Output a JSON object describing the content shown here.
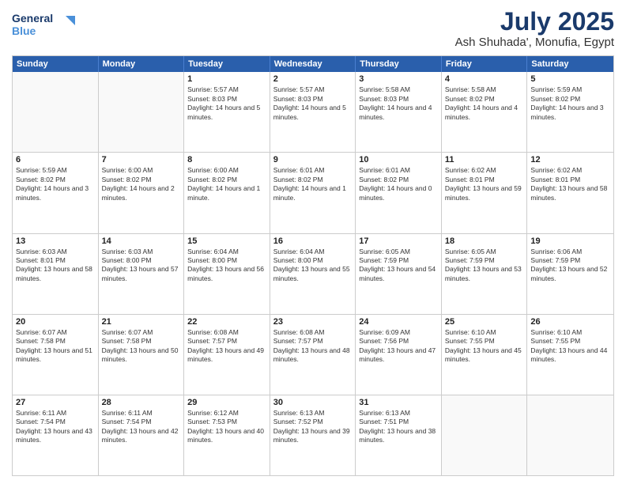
{
  "logo": {
    "line1": "General",
    "line2": "Blue"
  },
  "title": "July 2025",
  "location": "Ash Shuhada', Monufia, Egypt",
  "header_days": [
    "Sunday",
    "Monday",
    "Tuesday",
    "Wednesday",
    "Thursday",
    "Friday",
    "Saturday"
  ],
  "weeks": [
    [
      {
        "day": "",
        "sunrise": "",
        "sunset": "",
        "daylight": ""
      },
      {
        "day": "",
        "sunrise": "",
        "sunset": "",
        "daylight": ""
      },
      {
        "day": "1",
        "sunrise": "Sunrise: 5:57 AM",
        "sunset": "Sunset: 8:03 PM",
        "daylight": "Daylight: 14 hours and 5 minutes."
      },
      {
        "day": "2",
        "sunrise": "Sunrise: 5:57 AM",
        "sunset": "Sunset: 8:03 PM",
        "daylight": "Daylight: 14 hours and 5 minutes."
      },
      {
        "day": "3",
        "sunrise": "Sunrise: 5:58 AM",
        "sunset": "Sunset: 8:03 PM",
        "daylight": "Daylight: 14 hours and 4 minutes."
      },
      {
        "day": "4",
        "sunrise": "Sunrise: 5:58 AM",
        "sunset": "Sunset: 8:02 PM",
        "daylight": "Daylight: 14 hours and 4 minutes."
      },
      {
        "day": "5",
        "sunrise": "Sunrise: 5:59 AM",
        "sunset": "Sunset: 8:02 PM",
        "daylight": "Daylight: 14 hours and 3 minutes."
      }
    ],
    [
      {
        "day": "6",
        "sunrise": "Sunrise: 5:59 AM",
        "sunset": "Sunset: 8:02 PM",
        "daylight": "Daylight: 14 hours and 3 minutes."
      },
      {
        "day": "7",
        "sunrise": "Sunrise: 6:00 AM",
        "sunset": "Sunset: 8:02 PM",
        "daylight": "Daylight: 14 hours and 2 minutes."
      },
      {
        "day": "8",
        "sunrise": "Sunrise: 6:00 AM",
        "sunset": "Sunset: 8:02 PM",
        "daylight": "Daylight: 14 hours and 1 minute."
      },
      {
        "day": "9",
        "sunrise": "Sunrise: 6:01 AM",
        "sunset": "Sunset: 8:02 PM",
        "daylight": "Daylight: 14 hours and 1 minute."
      },
      {
        "day": "10",
        "sunrise": "Sunrise: 6:01 AM",
        "sunset": "Sunset: 8:02 PM",
        "daylight": "Daylight: 14 hours and 0 minutes."
      },
      {
        "day": "11",
        "sunrise": "Sunrise: 6:02 AM",
        "sunset": "Sunset: 8:01 PM",
        "daylight": "Daylight: 13 hours and 59 minutes."
      },
      {
        "day": "12",
        "sunrise": "Sunrise: 6:02 AM",
        "sunset": "Sunset: 8:01 PM",
        "daylight": "Daylight: 13 hours and 58 minutes."
      }
    ],
    [
      {
        "day": "13",
        "sunrise": "Sunrise: 6:03 AM",
        "sunset": "Sunset: 8:01 PM",
        "daylight": "Daylight: 13 hours and 58 minutes."
      },
      {
        "day": "14",
        "sunrise": "Sunrise: 6:03 AM",
        "sunset": "Sunset: 8:00 PM",
        "daylight": "Daylight: 13 hours and 57 minutes."
      },
      {
        "day": "15",
        "sunrise": "Sunrise: 6:04 AM",
        "sunset": "Sunset: 8:00 PM",
        "daylight": "Daylight: 13 hours and 56 minutes."
      },
      {
        "day": "16",
        "sunrise": "Sunrise: 6:04 AM",
        "sunset": "Sunset: 8:00 PM",
        "daylight": "Daylight: 13 hours and 55 minutes."
      },
      {
        "day": "17",
        "sunrise": "Sunrise: 6:05 AM",
        "sunset": "Sunset: 7:59 PM",
        "daylight": "Daylight: 13 hours and 54 minutes."
      },
      {
        "day": "18",
        "sunrise": "Sunrise: 6:05 AM",
        "sunset": "Sunset: 7:59 PM",
        "daylight": "Daylight: 13 hours and 53 minutes."
      },
      {
        "day": "19",
        "sunrise": "Sunrise: 6:06 AM",
        "sunset": "Sunset: 7:59 PM",
        "daylight": "Daylight: 13 hours and 52 minutes."
      }
    ],
    [
      {
        "day": "20",
        "sunrise": "Sunrise: 6:07 AM",
        "sunset": "Sunset: 7:58 PM",
        "daylight": "Daylight: 13 hours and 51 minutes."
      },
      {
        "day": "21",
        "sunrise": "Sunrise: 6:07 AM",
        "sunset": "Sunset: 7:58 PM",
        "daylight": "Daylight: 13 hours and 50 minutes."
      },
      {
        "day": "22",
        "sunrise": "Sunrise: 6:08 AM",
        "sunset": "Sunset: 7:57 PM",
        "daylight": "Daylight: 13 hours and 49 minutes."
      },
      {
        "day": "23",
        "sunrise": "Sunrise: 6:08 AM",
        "sunset": "Sunset: 7:57 PM",
        "daylight": "Daylight: 13 hours and 48 minutes."
      },
      {
        "day": "24",
        "sunrise": "Sunrise: 6:09 AM",
        "sunset": "Sunset: 7:56 PM",
        "daylight": "Daylight: 13 hours and 47 minutes."
      },
      {
        "day": "25",
        "sunrise": "Sunrise: 6:10 AM",
        "sunset": "Sunset: 7:55 PM",
        "daylight": "Daylight: 13 hours and 45 minutes."
      },
      {
        "day": "26",
        "sunrise": "Sunrise: 6:10 AM",
        "sunset": "Sunset: 7:55 PM",
        "daylight": "Daylight: 13 hours and 44 minutes."
      }
    ],
    [
      {
        "day": "27",
        "sunrise": "Sunrise: 6:11 AM",
        "sunset": "Sunset: 7:54 PM",
        "daylight": "Daylight: 13 hours and 43 minutes."
      },
      {
        "day": "28",
        "sunrise": "Sunrise: 6:11 AM",
        "sunset": "Sunset: 7:54 PM",
        "daylight": "Daylight: 13 hours and 42 minutes."
      },
      {
        "day": "29",
        "sunrise": "Sunrise: 6:12 AM",
        "sunset": "Sunset: 7:53 PM",
        "daylight": "Daylight: 13 hours and 40 minutes."
      },
      {
        "day": "30",
        "sunrise": "Sunrise: 6:13 AM",
        "sunset": "Sunset: 7:52 PM",
        "daylight": "Daylight: 13 hours and 39 minutes."
      },
      {
        "day": "31",
        "sunrise": "Sunrise: 6:13 AM",
        "sunset": "Sunset: 7:51 PM",
        "daylight": "Daylight: 13 hours and 38 minutes."
      },
      {
        "day": "",
        "sunrise": "",
        "sunset": "",
        "daylight": ""
      },
      {
        "day": "",
        "sunrise": "",
        "sunset": "",
        "daylight": ""
      }
    ]
  ]
}
